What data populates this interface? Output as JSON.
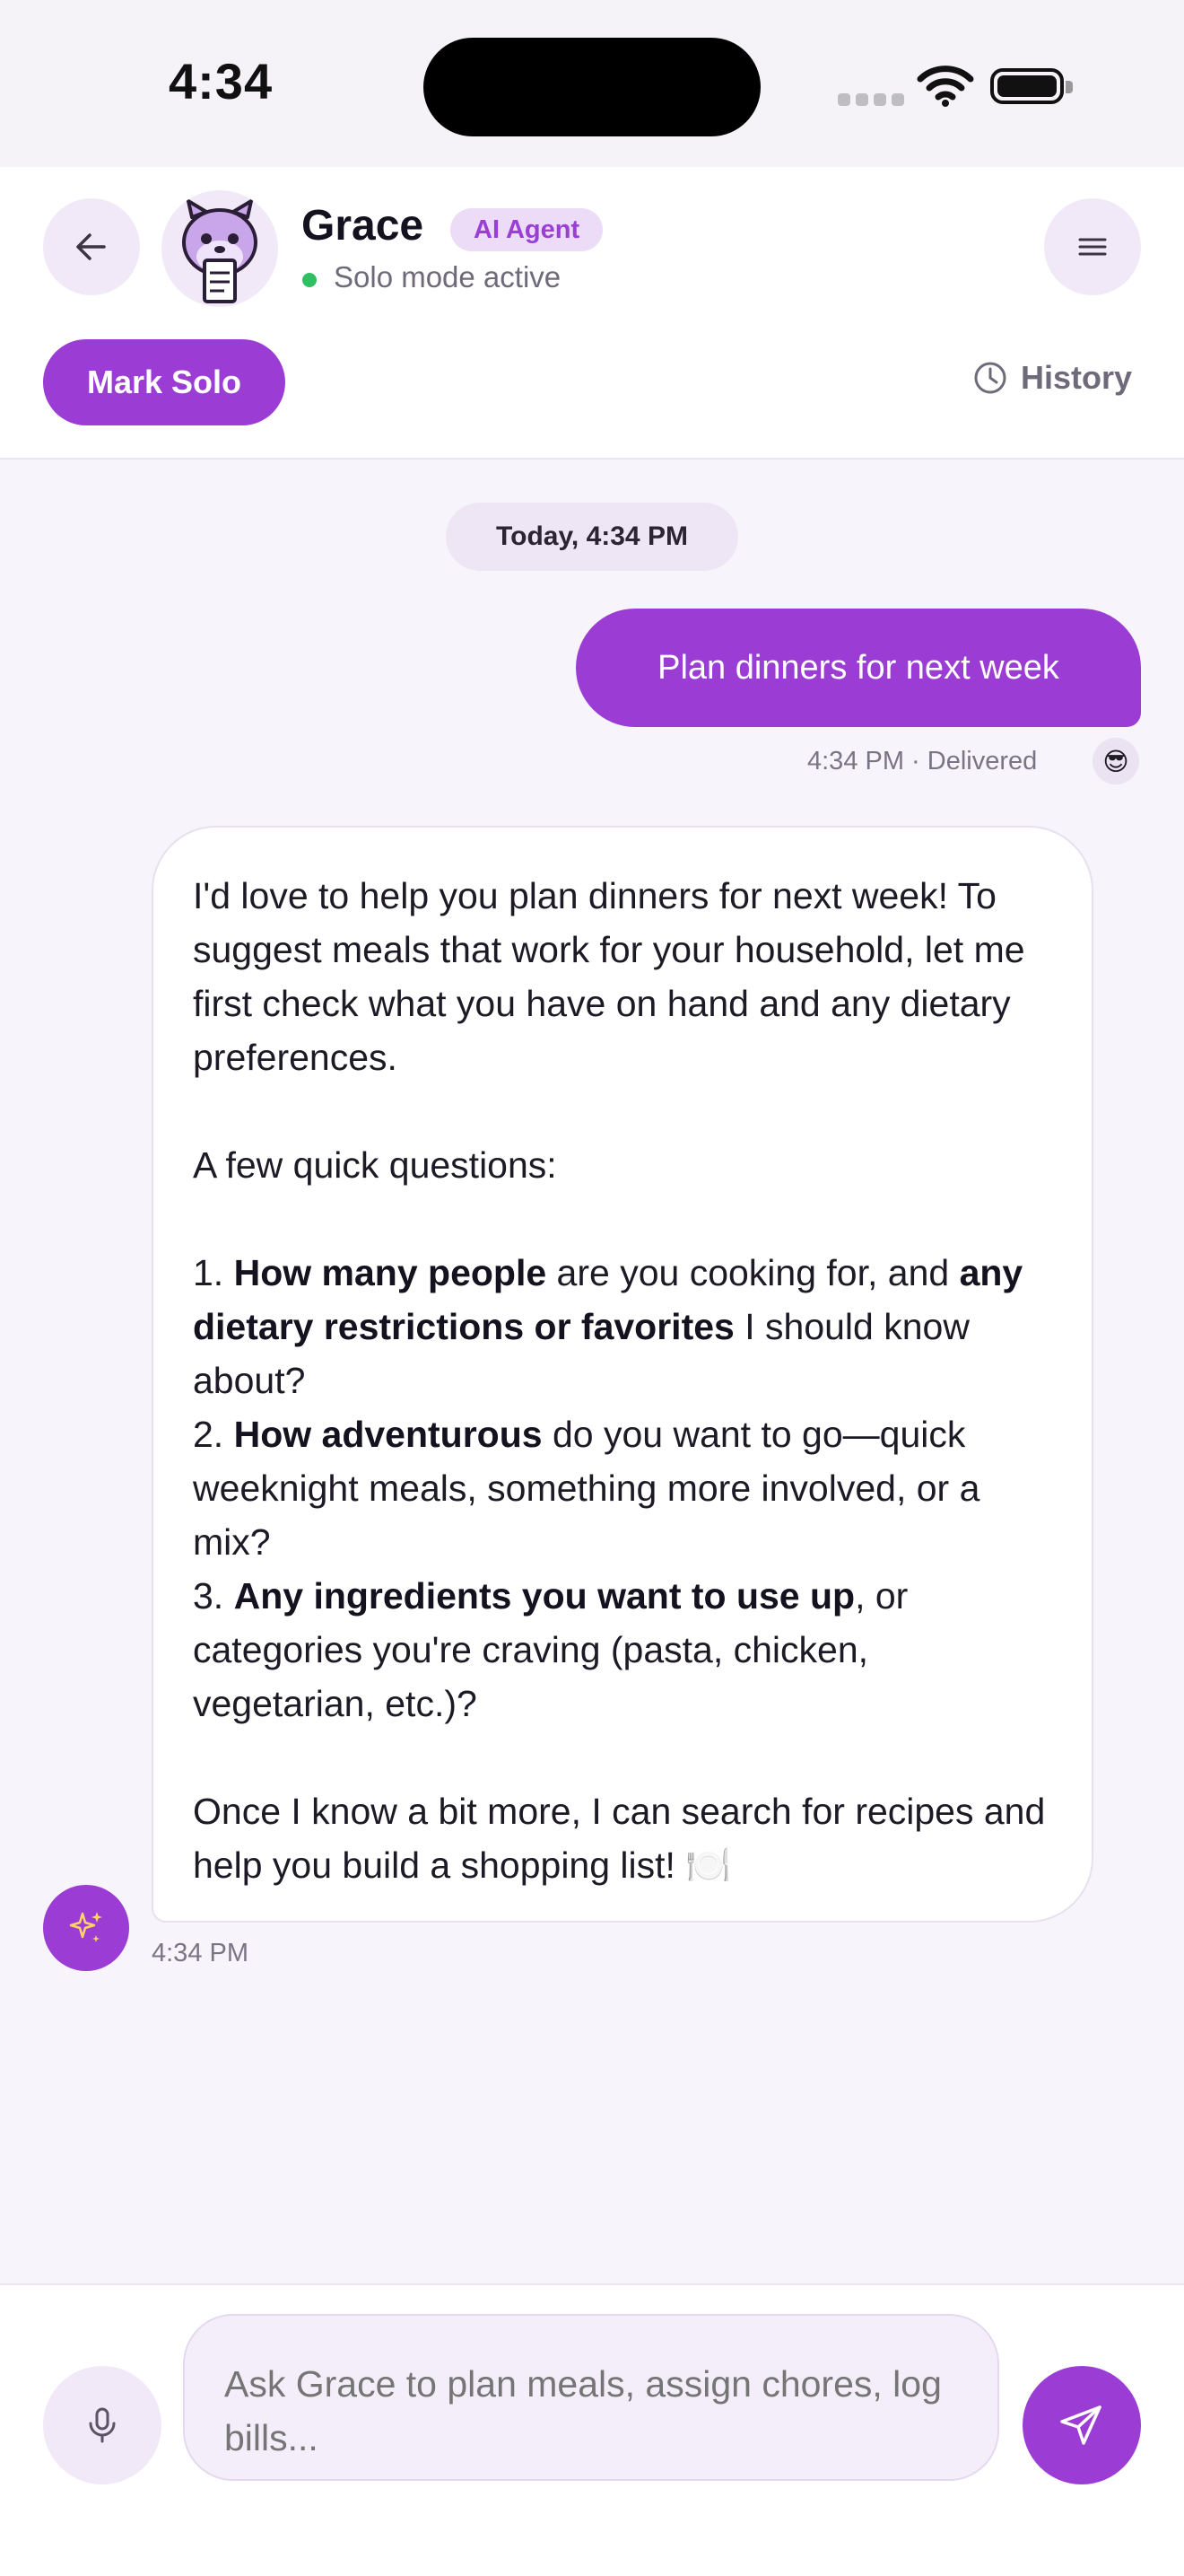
{
  "status_bar": {
    "time": "4:34"
  },
  "header": {
    "agent_name": "Grace",
    "agent_badge": "AI Agent",
    "status": "Solo mode active",
    "mark_solo_label": "Mark Solo",
    "history_label": "History",
    "icons": {
      "back": "arrow-left-icon",
      "menu": "hamburger-menu-icon",
      "history": "clock-icon",
      "avatar": "squirrel-avatar"
    }
  },
  "chat": {
    "date_divider": "Today, 4:34 PM",
    "user_message": {
      "text": "Plan dinners for next week",
      "meta": "4:34 PM · Delivered",
      "reaction": "😎"
    },
    "bot_message": {
      "intro": "I'd love to help you plan dinners for next week! To suggest meals that work for your household, let me first check what you have on hand and any dietary preferences.",
      "questions_heading": "A few quick questions:",
      "q1_num": "1. ",
      "q1_bold_a": "How many people",
      "q1_mid": " are you cooking for, and ",
      "q1_bold_b": "any dietary restrictions or favorites",
      "q1_end": " I should know about?",
      "q2_num": "2. ",
      "q2_bold": "How adventurous",
      "q2_end": " do you want to go—quick weeknight meals, something more involved, or a mix?",
      "q3_num": "3. ",
      "q3_bold": "Any ingredients you want to use up",
      "q3_end": ", or categories you're craving (pasta, chicken, vegetarian, etc.)?",
      "closing": "Once I know a bit more, I can search for recipes and help you build a shopping list! 🍽️",
      "time": "4:34 PM"
    }
  },
  "composer": {
    "placeholder": "Ask Grace to plan meals, assign chores, log bills...",
    "icons": {
      "mic": "microphone-icon",
      "send": "send-icon"
    }
  },
  "colors": {
    "accent": "#9b3dd4",
    "accent_soft": "#f1e9f8",
    "online": "#2fbf63"
  }
}
